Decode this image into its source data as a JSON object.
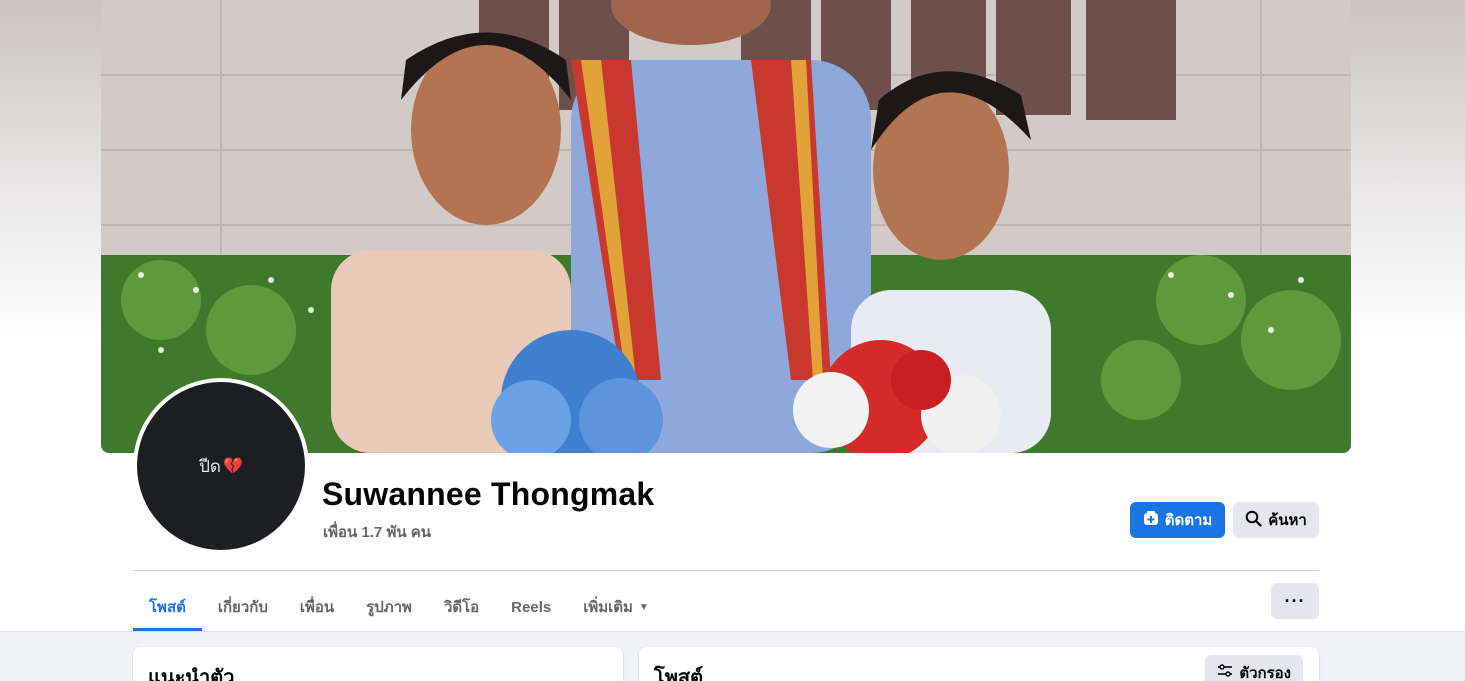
{
  "profile": {
    "name": "Suwannee Thongmak",
    "friends_count": "เพื่อน 1.7 พัน คน",
    "avatar_text": "ปีด",
    "avatar_emoji": "💔"
  },
  "actions": {
    "follow_label": "ติดตาม",
    "search_label": "ค้นหา",
    "more_label": "···"
  },
  "tabs": [
    {
      "label": "โพสต์",
      "active": true
    },
    {
      "label": "เกี่ยวกับ"
    },
    {
      "label": "เพื่อน"
    },
    {
      "label": "รูปภาพ"
    },
    {
      "label": "วิดีโอ"
    },
    {
      "label": "Reels"
    },
    {
      "label": "เพิ่มเติม"
    }
  ],
  "intro_card": {
    "title": "แนะนำตัว"
  },
  "posts_card": {
    "title": "โพสต์",
    "filter_label": "ตัวกรอง"
  },
  "colors": {
    "accent": "#1b74e4",
    "secondary_button": "#e4e6eb",
    "muted_text": "#65676b"
  },
  "icons": [
    "follow-icon",
    "search-icon",
    "chevron-down-icon",
    "more-icon",
    "filter-icon"
  ]
}
